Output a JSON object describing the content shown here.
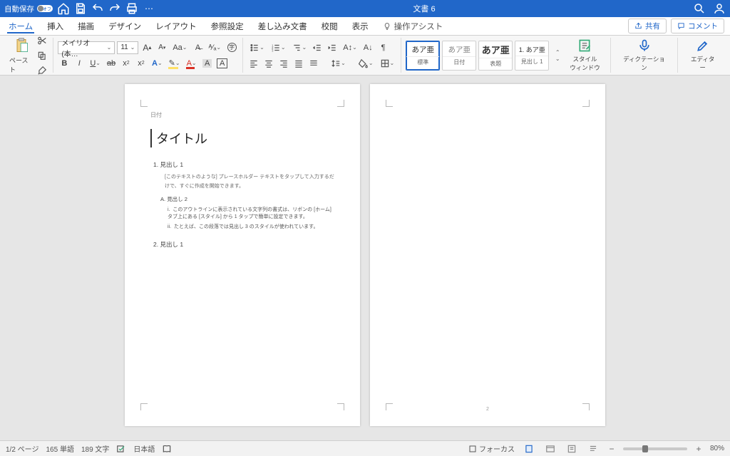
{
  "titlebar": {
    "autosave_label": "自動保存",
    "autosave_toggle_text": "オフ",
    "doc_title": "文書 6"
  },
  "tabs": {
    "items": [
      "ホーム",
      "挿入",
      "描画",
      "デザイン",
      "レイアウト",
      "参照設定",
      "差し込み文書",
      "校閲",
      "表示"
    ],
    "tell_me": "操作アシスト",
    "share": "共有",
    "comments": "コメント"
  },
  "ribbon": {
    "paste": "ペースト",
    "font_name": "メイリオ (本…",
    "font_size": "11",
    "styles": [
      {
        "preview": "あア亜",
        "name": "標準"
      },
      {
        "preview": "あア亜",
        "name": "日付"
      },
      {
        "preview": "あア亜",
        "name": "表題"
      },
      {
        "preview": "1. あア亜",
        "name": "見出し 1"
      }
    ],
    "styles_pane": "スタイル\nウィンドウ",
    "dictation": "ディクテーション",
    "editor": "エディター"
  },
  "document": {
    "meta": "日付",
    "title": "タイトル",
    "h1_1_num": "1.",
    "h1_1": "見出し 1",
    "body1": "[このテキストのような] プレースホルダー テキストをタップして入力するだけで、すぐに作成を開始できます。",
    "h2_a_num": "A.",
    "h2_a": "見出し 2",
    "h3_i_num": "i.",
    "h3_i": "このアウトラインに表示されている文字列の書式は、リボンの [ホーム] タブ上にある [スタイル] から 1 タップで簡単に設定できます。",
    "h3_ii_num": "ii.",
    "h3_ii": "たとえば、この段落では見出し 3 のスタイルが使われています。",
    "h1_2_num": "2.",
    "h1_2": "見出し 1",
    "page2_num": "2"
  },
  "status": {
    "page": "1/2 ページ",
    "words": "165 単語",
    "chars": "189 文字",
    "lang": "日本語",
    "focus": "フォーカス",
    "zoom": "80%"
  }
}
